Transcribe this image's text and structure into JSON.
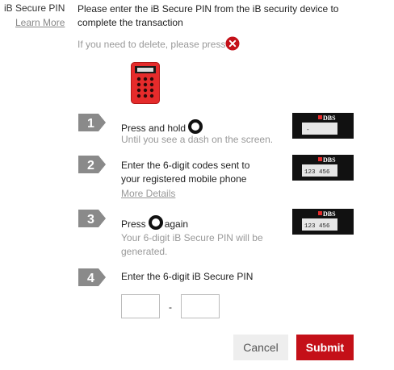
{
  "field": {
    "label": "iB Secure PIN",
    "learn_more": "Learn More"
  },
  "instruction": "Please enter the iB Secure PIN from the iB security device to complete the transaction",
  "delete_hint": "If you need to delete, please press",
  "steps": [
    {
      "number": "1",
      "title": "Press and hold",
      "subtitle": "Until you see a dash on the screen.",
      "screen_text": "-"
    },
    {
      "number": "2",
      "title_line1": "Enter the 6-digit codes sent to",
      "title_line2": "your registered mobile phone",
      "link": "More Details",
      "screen_text": "123 456"
    },
    {
      "number": "3",
      "title_before": "Press",
      "title_after": "again",
      "subtitle_line1": "Your 6-digit iB Secure PIN will be",
      "subtitle_line2": "generated.",
      "screen_text": "123 456"
    },
    {
      "number": "4",
      "title": "Enter the 6-digit iB Secure PIN"
    }
  ],
  "device_brand": "DBS",
  "pin": {
    "first_value": "",
    "second_value": "",
    "separator": "-"
  },
  "buttons": {
    "cancel": "Cancel",
    "submit": "Submit"
  },
  "colors": {
    "accent_red": "#c41018",
    "badge_gray": "#8a8a8a",
    "muted_text": "#999999"
  },
  "icons": {
    "delete": "red-x-circle-icon",
    "hold": "circle-button-icon",
    "device": "security-token-icon"
  }
}
